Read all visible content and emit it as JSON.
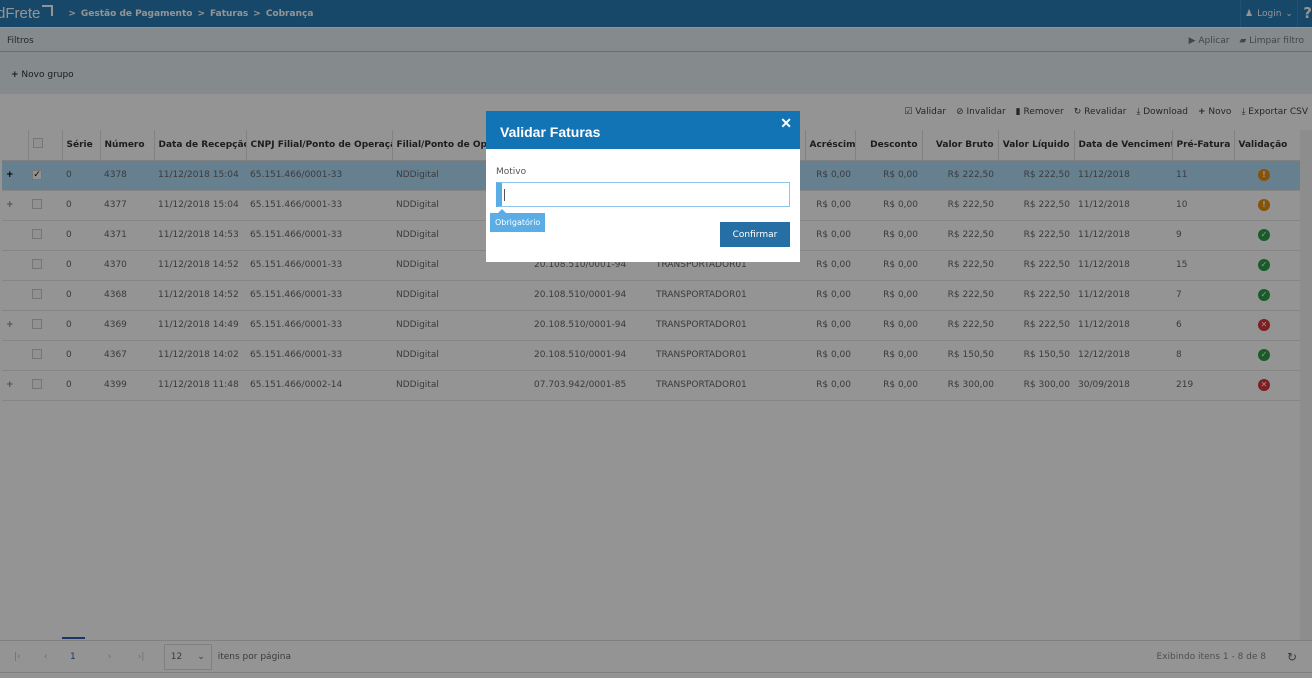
{
  "header": {
    "logo": "dFrete",
    "breadcrumb": [
      "Gestão de Pagamento",
      "Faturas",
      "Cobrança"
    ],
    "login": "Login",
    "help": "?"
  },
  "filters": {
    "title": "Filtros",
    "apply": "Aplicar",
    "clear": "Limpar filtro",
    "new_group": "Novo grupo"
  },
  "toolbar": {
    "validate": "Validar",
    "invalidate": "Invalidar",
    "remove": "Remover",
    "revalidate": "Revalidar",
    "download": "Download",
    "new": "Novo",
    "export": "Exportar CSV"
  },
  "table": {
    "columns": [
      "",
      "",
      "Série",
      "Número",
      "Data de Recepção ↓",
      "CNPJ Filial/Ponto de Operação",
      "Filial/Ponto de Operação",
      "",
      "",
      "Acréscimo",
      "Desconto",
      "Valor Bruto",
      "Valor Líquido",
      "Data de Vencimento",
      "Pré-Fatura",
      "Validação"
    ],
    "rows": [
      {
        "expand": "+",
        "checked": true,
        "selected": true,
        "serie": "0",
        "numero": "4378",
        "data": "11/12/2018 15:04",
        "cnpj": "65.151.466/0001-33",
        "filial": "NDDigital",
        "cnpj2": "",
        "nome": "",
        "acrescimo": "R$ 0,00",
        "desconto": "R$ 0,00",
        "bruto": "R$ 222,50",
        "liquido": "R$ 222,50",
        "venc": "11/12/2018",
        "pre": "11",
        "validacao": "warning"
      },
      {
        "expand": "+",
        "checked": false,
        "serie": "0",
        "numero": "4377",
        "data": "11/12/2018 15:04",
        "cnpj": "65.151.466/0001-33",
        "filial": "NDDigital",
        "cnpj2": "",
        "nome": "",
        "acrescimo": "R$ 0,00",
        "desconto": "R$ 0,00",
        "bruto": "R$ 222,50",
        "liquido": "R$ 222,50",
        "venc": "11/12/2018",
        "pre": "10",
        "validacao": "warning"
      },
      {
        "expand": "",
        "checked": false,
        "serie": "0",
        "numero": "4371",
        "data": "11/12/2018 14:53",
        "cnpj": "65.151.466/0001-33",
        "filial": "NDDigital",
        "cnpj2": "",
        "nome": "",
        "acrescimo": "R$ 0,00",
        "desconto": "R$ 0,00",
        "bruto": "R$ 222,50",
        "liquido": "R$ 222,50",
        "venc": "11/12/2018",
        "pre": "9",
        "validacao": "ok"
      },
      {
        "expand": "",
        "checked": false,
        "serie": "0",
        "numero": "4370",
        "data": "11/12/2018 14:52",
        "cnpj": "65.151.466/0001-33",
        "filial": "NDDigital",
        "cnpj2": "20.108.510/0001-94",
        "nome": "TRANSPORTADOR01",
        "acrescimo": "R$ 0,00",
        "desconto": "R$ 0,00",
        "bruto": "R$ 222,50",
        "liquido": "R$ 222,50",
        "venc": "11/12/2018",
        "pre": "15",
        "validacao": "ok"
      },
      {
        "expand": "",
        "checked": false,
        "serie": "0",
        "numero": "4368",
        "data": "11/12/2018 14:52",
        "cnpj": "65.151.466/0001-33",
        "filial": "NDDigital",
        "cnpj2": "20.108.510/0001-94",
        "nome": "TRANSPORTADOR01",
        "acrescimo": "R$ 0,00",
        "desconto": "R$ 0,00",
        "bruto": "R$ 222,50",
        "liquido": "R$ 222,50",
        "venc": "11/12/2018",
        "pre": "7",
        "validacao": "ok"
      },
      {
        "expand": "+",
        "checked": false,
        "serie": "0",
        "numero": "4369",
        "data": "11/12/2018 14:49",
        "cnpj": "65.151.466/0001-33",
        "filial": "NDDigital",
        "cnpj2": "20.108.510/0001-94",
        "nome": "TRANSPORTADOR01",
        "acrescimo": "R$ 0,00",
        "desconto": "R$ 0,00",
        "bruto": "R$ 222,50",
        "liquido": "R$ 222,50",
        "venc": "11/12/2018",
        "pre": "6",
        "validacao": "error"
      },
      {
        "expand": "",
        "checked": false,
        "serie": "0",
        "numero": "4367",
        "data": "11/12/2018 14:02",
        "cnpj": "65.151.466/0001-33",
        "filial": "NDDigital",
        "cnpj2": "20.108.510/0001-94",
        "nome": "TRANSPORTADOR01",
        "acrescimo": "R$ 0,00",
        "desconto": "R$ 0,00",
        "bruto": "R$ 150,50",
        "liquido": "R$ 150,50",
        "venc": "12/12/2018",
        "pre": "8",
        "validacao": "ok"
      },
      {
        "expand": "+",
        "checked": false,
        "serie": "0",
        "numero": "4399",
        "data": "11/12/2018 11:48",
        "cnpj": "65.151.466/0002-14",
        "filial": "NDDigital",
        "cnpj2": "07.703.942/0001-85",
        "nome": "TRANSPORTADOR01",
        "acrescimo": "R$ 0,00",
        "desconto": "R$ 0,00",
        "bruto": "R$ 300,00",
        "liquido": "R$ 300,00",
        "venc": "30/09/2018",
        "pre": "219",
        "validacao": "error"
      }
    ]
  },
  "status_colors": {
    "warning": "#e8900c",
    "ok": "#2e9e48",
    "error": "#d9343a"
  },
  "pager": {
    "page": "1",
    "page_size": "12",
    "per_page_label": "itens por página",
    "info": "Exibindo itens 1 - 8 de 8"
  },
  "modal": {
    "title": "Validar Faturas",
    "label": "Motivo",
    "value": "",
    "tooltip": "Obrigatório",
    "confirm": "Confirmar"
  }
}
